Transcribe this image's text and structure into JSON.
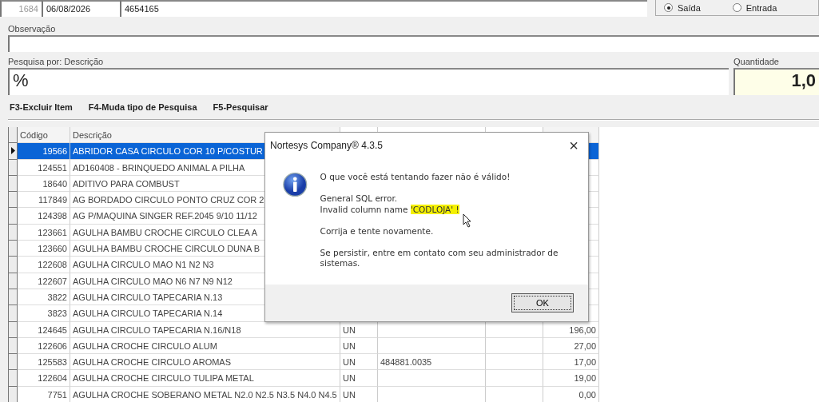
{
  "header": {
    "number": "1684",
    "date": "06/08/2026",
    "document": "4654165"
  },
  "direction": [
    {
      "label": "Saída",
      "selected": true
    },
    {
      "label": "Entrada",
      "selected": false
    }
  ],
  "observation": {
    "label": "Observação"
  },
  "search": {
    "label": "Pesquisa por: Descrição",
    "value": "%"
  },
  "quantity": {
    "label": "Quantidade",
    "value": "1,0"
  },
  "shortcuts": [
    "F3-Excluir Item",
    "F4-Muda tipo de Pesquisa",
    "F5-Pesquisar"
  ],
  "table": {
    "columns": [
      "Código",
      "Descrição"
    ],
    "rows": [
      {
        "code": "19566",
        "description": "ABRIDOR CASA CIRCULO COR 10 P/COSTUR",
        "selected": true
      },
      {
        "code": "124551",
        "description": "AD160408 - BRINQUEDO ANIMAL A PILHA",
        "selected": false
      },
      {
        "code": "18640",
        "description": "ADITIVO PARA COMBUST",
        "selected": false
      },
      {
        "code": "117849",
        "description": "AG BORDADO CIRCULO PONTO CRUZ COR 2",
        "selected": false
      },
      {
        "code": "124398",
        "description": "AG P/MAQUINA SINGER REF.2045 9/10 11/12",
        "selected": false
      },
      {
        "code": "123661",
        "description": "AGULHA BAMBU CROCHE CIRCULO CLEA A",
        "selected": false
      },
      {
        "code": "123660",
        "description": "AGULHA BAMBU CROCHE CIRCULO DUNA B",
        "selected": false
      },
      {
        "code": "122608",
        "description": "AGULHA CIRCULO MAO N1 N2 N3",
        "selected": false
      },
      {
        "code": "122607",
        "description": "AGULHA CIRCULO MAO N6 N7 N9 N12",
        "selected": false
      },
      {
        "code": "3822",
        "description": "AGULHA CIRCULO TAPECARIA N.13",
        "selected": false
      },
      {
        "code": "3823",
        "description": "AGULHA CIRCULO TAPECARIA N.14",
        "selected": false
      },
      {
        "code": "124645",
        "description": "AGULHA CIRCULO TAPECARIA N.16/N18",
        "column_3": "UN",
        "column_7": "196,00",
        "selected": false
      },
      {
        "code": "122606",
        "description": "AGULHA CROCHE CIRCULO ALUM",
        "column_3": "UN",
        "column_7": "27,00",
        "selected": false
      },
      {
        "code": "125583",
        "description": "AGULHA CROCHE CIRCULO AROMAS",
        "column_3": "UN",
        "column_4": "484881.0035",
        "column_7": "17,00",
        "selected": false
      },
      {
        "code": "122604",
        "description": "AGULHA CROCHE CIRCULO TULIPA METAL",
        "column_3": "UN",
        "column_7": "19,00",
        "selected": false
      },
      {
        "code": "7751",
        "description": "AGULHA CROCHE SOBERANO METAL N2.0 N2.5 N3.5 N4.0 N4.5",
        "column_3": "UN",
        "column_7": "0,00",
        "selected": false
      }
    ]
  },
  "dialog": {
    "title": "Nortesys Company® 4.3.5",
    "close": "×",
    "lines": [
      {
        "text": "O que você está tentando fazer não é válido!"
      },
      {
        "text": "General SQL error.",
        "gap": true
      },
      {
        "text": "Invalid column name ",
        "highlight": "'CODLOJA' !"
      },
      {
        "text": "Corrija e tente novamente.",
        "gap": true
      },
      {
        "text": "Se persistir, entre em contato com seu administrador de sistemas.",
        "gap": true
      }
    ],
    "button": "OK"
  }
}
